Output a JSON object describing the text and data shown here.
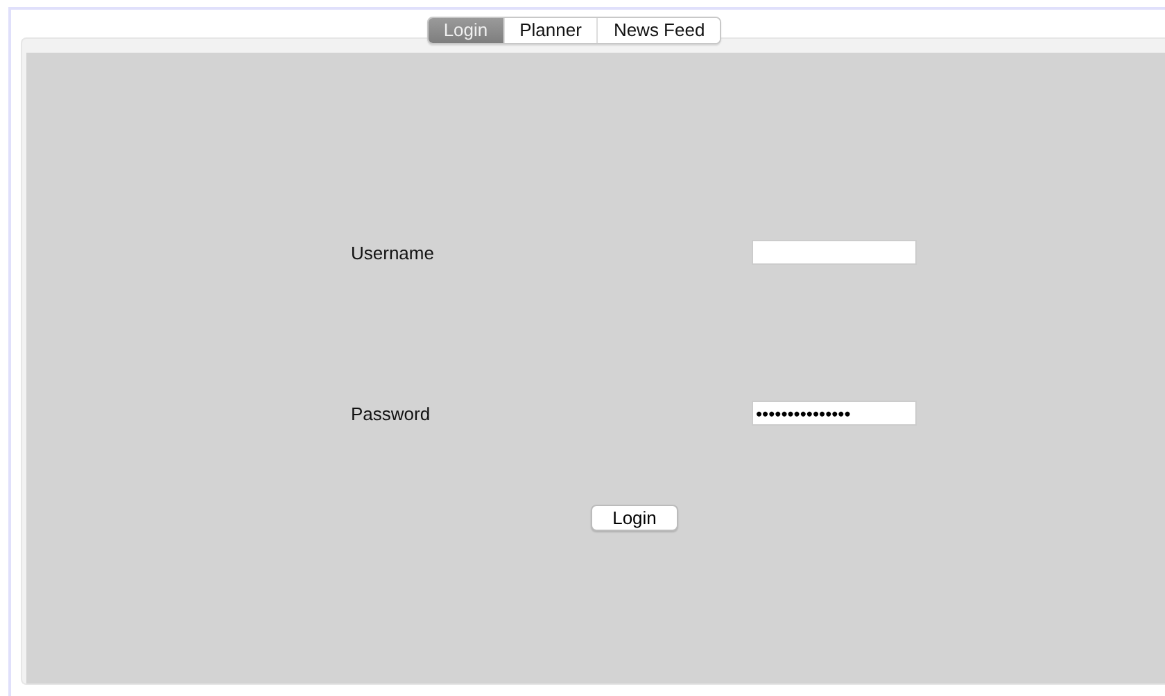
{
  "tabs": [
    {
      "label": "Login",
      "selected": true
    },
    {
      "label": "Planner",
      "selected": false
    },
    {
      "label": "News Feed",
      "selected": false
    }
  ],
  "form": {
    "fields": [
      {
        "label": "Username",
        "kind": "text"
      },
      {
        "label": "Password",
        "value": "•••••••••••••••",
        "kind": "password"
      }
    ],
    "button": "Login"
  }
}
